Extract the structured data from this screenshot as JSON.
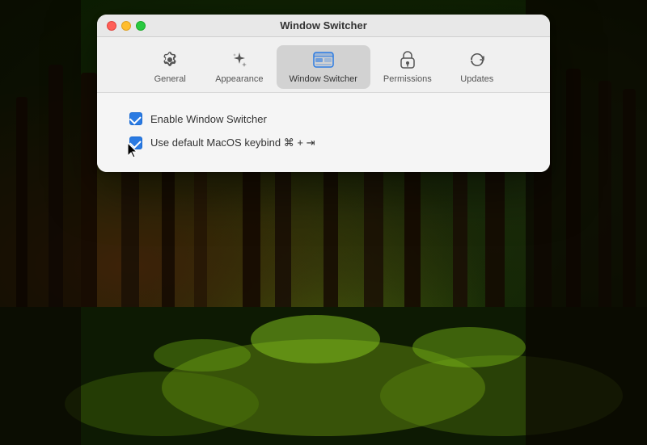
{
  "window": {
    "title": "Window Switcher"
  },
  "toolbar": {
    "items": [
      {
        "id": "general",
        "label": "General",
        "icon": "gear"
      },
      {
        "id": "appearance",
        "label": "Appearance",
        "icon": "sparkle"
      },
      {
        "id": "window-switcher",
        "label": "Window Switcher",
        "icon": "window-switcher",
        "active": true
      },
      {
        "id": "permissions",
        "label": "Permissions",
        "icon": "lock"
      },
      {
        "id": "updates",
        "label": "Updates",
        "icon": "refresh"
      }
    ]
  },
  "content": {
    "checkboxes": [
      {
        "id": "enable-window-switcher",
        "label": "Enable Window Switcher",
        "checked": true
      },
      {
        "id": "use-default-keybind",
        "label": "Use default MacOS keybind ⌘ + ⇥",
        "checked": true,
        "cursor": true
      }
    ]
  }
}
